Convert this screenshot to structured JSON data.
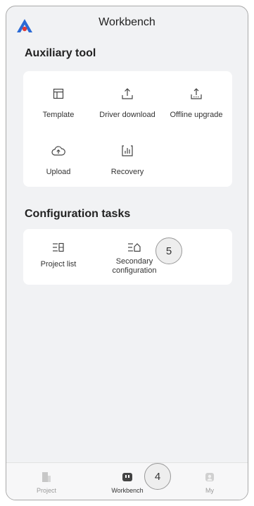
{
  "header": {
    "title": "Workbench",
    "logo_icon": "app-logo-icon"
  },
  "auxiliary": {
    "title": "Auxiliary tool",
    "items": [
      {
        "label": "Template",
        "icon": "template-icon"
      },
      {
        "label": "Driver download",
        "icon": "download-icon"
      },
      {
        "label": "Offline upgrade",
        "icon": "upgrade-icon"
      },
      {
        "label": "Upload",
        "icon": "cloud-upload-icon"
      },
      {
        "label": "Recovery",
        "icon": "recovery-icon"
      }
    ]
  },
  "configuration": {
    "title": "Configuration tasks",
    "items": [
      {
        "label": "Project list",
        "icon": "project-list-icon"
      },
      {
        "label_line1": "Secondary",
        "label_line2": "configuration",
        "icon": "secondary-config-icon"
      }
    ]
  },
  "nav": {
    "items": [
      {
        "label": "Project",
        "icon": "project-icon"
      },
      {
        "label": "Workbench",
        "icon": "workbench-icon",
        "active": true
      },
      {
        "label": "My",
        "icon": "user-icon"
      }
    ]
  },
  "annotations": {
    "marker_5": "5",
    "marker_4": "4"
  },
  "colors": {
    "background": "#f1f2f4",
    "card": "#ffffff",
    "logo_blue": "#2a6ad6",
    "logo_red": "#e03a3a",
    "nav_active": "#444444",
    "nav_inactive": "#c7c7c7"
  }
}
